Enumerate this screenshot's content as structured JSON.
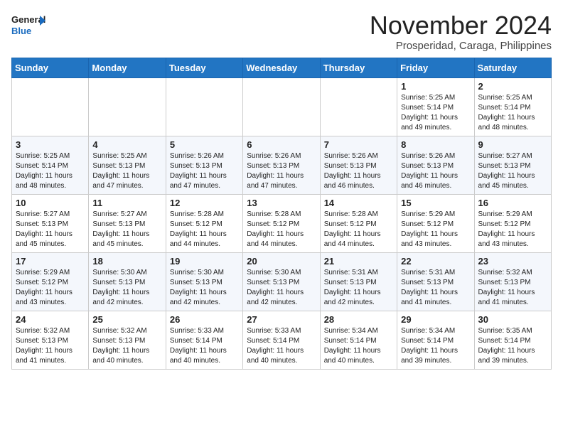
{
  "logo": {
    "general": "General",
    "blue": "Blue"
  },
  "header": {
    "month": "November 2024",
    "location": "Prosperidad, Caraga, Philippines"
  },
  "days": [
    "Sunday",
    "Monday",
    "Tuesday",
    "Wednesday",
    "Thursday",
    "Friday",
    "Saturday"
  ],
  "weeks": [
    [
      {
        "day": "",
        "info": ""
      },
      {
        "day": "",
        "info": ""
      },
      {
        "day": "",
        "info": ""
      },
      {
        "day": "",
        "info": ""
      },
      {
        "day": "",
        "info": ""
      },
      {
        "day": "1",
        "info": "Sunrise: 5:25 AM\nSunset: 5:14 PM\nDaylight: 11 hours\nand 49 minutes."
      },
      {
        "day": "2",
        "info": "Sunrise: 5:25 AM\nSunset: 5:14 PM\nDaylight: 11 hours\nand 48 minutes."
      }
    ],
    [
      {
        "day": "3",
        "info": "Sunrise: 5:25 AM\nSunset: 5:14 PM\nDaylight: 11 hours\nand 48 minutes."
      },
      {
        "day": "4",
        "info": "Sunrise: 5:25 AM\nSunset: 5:13 PM\nDaylight: 11 hours\nand 47 minutes."
      },
      {
        "day": "5",
        "info": "Sunrise: 5:26 AM\nSunset: 5:13 PM\nDaylight: 11 hours\nand 47 minutes."
      },
      {
        "day": "6",
        "info": "Sunrise: 5:26 AM\nSunset: 5:13 PM\nDaylight: 11 hours\nand 47 minutes."
      },
      {
        "day": "7",
        "info": "Sunrise: 5:26 AM\nSunset: 5:13 PM\nDaylight: 11 hours\nand 46 minutes."
      },
      {
        "day": "8",
        "info": "Sunrise: 5:26 AM\nSunset: 5:13 PM\nDaylight: 11 hours\nand 46 minutes."
      },
      {
        "day": "9",
        "info": "Sunrise: 5:27 AM\nSunset: 5:13 PM\nDaylight: 11 hours\nand 45 minutes."
      }
    ],
    [
      {
        "day": "10",
        "info": "Sunrise: 5:27 AM\nSunset: 5:13 PM\nDaylight: 11 hours\nand 45 minutes."
      },
      {
        "day": "11",
        "info": "Sunrise: 5:27 AM\nSunset: 5:13 PM\nDaylight: 11 hours\nand 45 minutes."
      },
      {
        "day": "12",
        "info": "Sunrise: 5:28 AM\nSunset: 5:12 PM\nDaylight: 11 hours\nand 44 minutes."
      },
      {
        "day": "13",
        "info": "Sunrise: 5:28 AM\nSunset: 5:12 PM\nDaylight: 11 hours\nand 44 minutes."
      },
      {
        "day": "14",
        "info": "Sunrise: 5:28 AM\nSunset: 5:12 PM\nDaylight: 11 hours\nand 44 minutes."
      },
      {
        "day": "15",
        "info": "Sunrise: 5:29 AM\nSunset: 5:12 PM\nDaylight: 11 hours\nand 43 minutes."
      },
      {
        "day": "16",
        "info": "Sunrise: 5:29 AM\nSunset: 5:12 PM\nDaylight: 11 hours\nand 43 minutes."
      }
    ],
    [
      {
        "day": "17",
        "info": "Sunrise: 5:29 AM\nSunset: 5:12 PM\nDaylight: 11 hours\nand 43 minutes."
      },
      {
        "day": "18",
        "info": "Sunrise: 5:30 AM\nSunset: 5:13 PM\nDaylight: 11 hours\nand 42 minutes."
      },
      {
        "day": "19",
        "info": "Sunrise: 5:30 AM\nSunset: 5:13 PM\nDaylight: 11 hours\nand 42 minutes."
      },
      {
        "day": "20",
        "info": "Sunrise: 5:30 AM\nSunset: 5:13 PM\nDaylight: 11 hours\nand 42 minutes."
      },
      {
        "day": "21",
        "info": "Sunrise: 5:31 AM\nSunset: 5:13 PM\nDaylight: 11 hours\nand 42 minutes."
      },
      {
        "day": "22",
        "info": "Sunrise: 5:31 AM\nSunset: 5:13 PM\nDaylight: 11 hours\nand 41 minutes."
      },
      {
        "day": "23",
        "info": "Sunrise: 5:32 AM\nSunset: 5:13 PM\nDaylight: 11 hours\nand 41 minutes."
      }
    ],
    [
      {
        "day": "24",
        "info": "Sunrise: 5:32 AM\nSunset: 5:13 PM\nDaylight: 11 hours\nand 41 minutes."
      },
      {
        "day": "25",
        "info": "Sunrise: 5:32 AM\nSunset: 5:13 PM\nDaylight: 11 hours\nand 40 minutes."
      },
      {
        "day": "26",
        "info": "Sunrise: 5:33 AM\nSunset: 5:14 PM\nDaylight: 11 hours\nand 40 minutes."
      },
      {
        "day": "27",
        "info": "Sunrise: 5:33 AM\nSunset: 5:14 PM\nDaylight: 11 hours\nand 40 minutes."
      },
      {
        "day": "28",
        "info": "Sunrise: 5:34 AM\nSunset: 5:14 PM\nDaylight: 11 hours\nand 40 minutes."
      },
      {
        "day": "29",
        "info": "Sunrise: 5:34 AM\nSunset: 5:14 PM\nDaylight: 11 hours\nand 39 minutes."
      },
      {
        "day": "30",
        "info": "Sunrise: 5:35 AM\nSunset: 5:14 PM\nDaylight: 11 hours\nand 39 minutes."
      }
    ]
  ]
}
